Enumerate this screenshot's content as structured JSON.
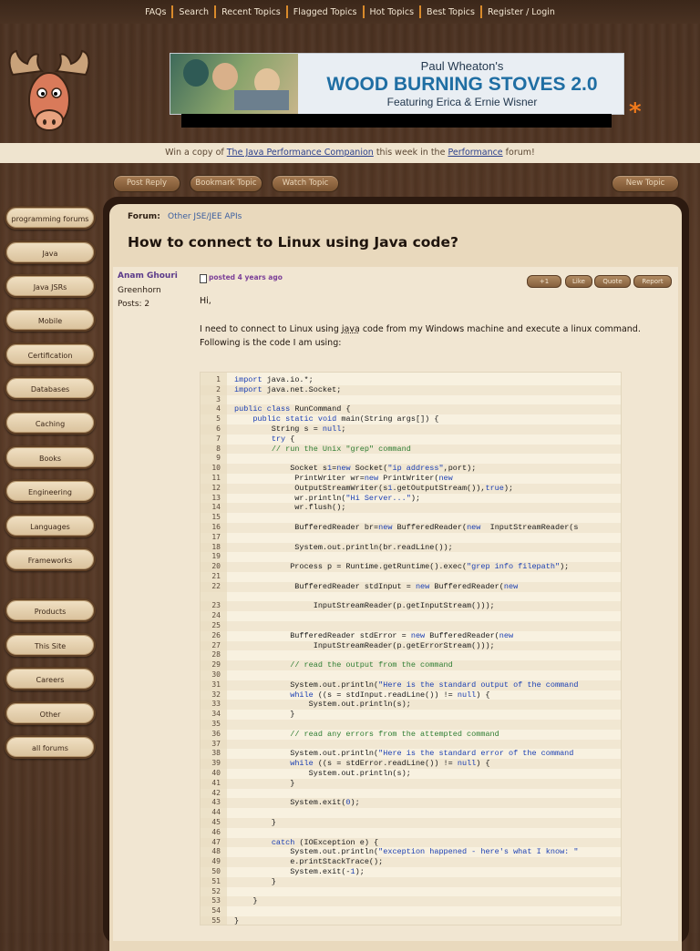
{
  "nav": {
    "items": [
      "FAQs",
      "Search",
      "Recent Topics",
      "Flagged Topics",
      "Hot Topics",
      "Best Topics",
      "Register / Login"
    ]
  },
  "banner": {
    "line1": "Paul Wheaton's",
    "line2": "WOOD BURNING STOVES 2.0",
    "line3": "Featuring Erica & Ernie Wisner"
  },
  "promo": {
    "prefix": "Win a copy of ",
    "book": "The Java Performance Companion",
    "middle": " this week in the ",
    "forum": "Performance",
    "suffix": " forum!"
  },
  "actions": {
    "post_reply": "Post Reply",
    "bookmark": "Bookmark Topic",
    "watch": "Watch Topic",
    "new_topic": "New Topic"
  },
  "sidebar": {
    "items": [
      "programming forums",
      "Java",
      "Java JSRs",
      "Mobile",
      "Certification",
      "Databases",
      "Caching",
      "Books",
      "Engineering",
      "Languages",
      "Frameworks",
      "Products",
      "This Site",
      "Careers",
      "Other",
      "all forums"
    ]
  },
  "topic": {
    "forum_label": "Forum:",
    "forum_name": "Other JSE/JEE APIs",
    "title": "How to connect to Linux using Java code?"
  },
  "post": {
    "author": "Anam Ghouri",
    "rank": "Greenhorn",
    "posts": "Posts: 2",
    "posted": "posted 4 years ago",
    "buttons": [
      "+1",
      "Like",
      "Quote",
      "Report"
    ],
    "greeting": "Hi,",
    "body_before": "I need to connect to Linux using ",
    "body_link": "java",
    "body_after": " code from my Windows machine and execute a linux command. Following is the code I am using:"
  },
  "code_lines": [
    "import java.io.*;",
    "import java.net.Socket;",
    "",
    "public class RunCommand {",
    "    public static void main(String args[]) {",
    "        String s = null;",
    "        try {",
    "        // run the Unix \"grep\" command",
    "",
    "            Socket s1=new Socket(\"ip address\",port);",
    "             PrintWriter wr=new PrintWriter(new",
    "             OutputStreamWriter(s1.getOutputStream()),true);",
    "             wr.println(\"Hi Server...\");",
    "             wr.flush();",
    "",
    "             BufferedReader br=new BufferedReader(new  InputStreamReader(s",
    "",
    "             System.out.println(br.readLine());",
    "",
    "            Process p = Runtime.getRuntime().exec(\"grep info filepath\");",
    "",
    "             BufferedReader stdInput = new BufferedReader(new",
    "",
    "                 InputStreamReader(p.getInputStream()));",
    "",
    "",
    "            BufferedReader stdError = new BufferedReader(new",
    "                 InputStreamReader(p.getErrorStream()));",
    "",
    "            // read the output from the command",
    "",
    "            System.out.println(\"Here is the standard output of the command",
    "            while ((s = stdInput.readLine()) != null) {",
    "                System.out.println(s);",
    "            }",
    "",
    "            // read any errors from the attempted command",
    "",
    "            System.out.println(\"Here is the standard error of the command",
    "            while ((s = stdError.readLine()) != null) {",
    "                System.out.println(s);",
    "            }",
    "",
    "            System.exit(0);",
    "",
    "        }",
    "",
    "        catch (IOException e) {",
    "            System.out.println(\"exception happened - here's what I know: \"",
    "            e.printStackTrace();",
    "            System.exit(-1);",
    "        }",
    "",
    "    }",
    "",
    "}"
  ],
  "code_line_numbers": [
    "1",
    "2",
    "3",
    "4",
    "5",
    "6",
    "7",
    "8",
    "9",
    "10",
    "11",
    "12",
    "13",
    "14",
    "15",
    "16",
    "17",
    "18",
    "19",
    "20",
    "21",
    "22",
    "",
    "23",
    "24",
    "25",
    "26",
    "27",
    "28",
    "29",
    "30",
    "31",
    "32",
    "33",
    "34",
    "35",
    "36",
    "37",
    "38",
    "39",
    "40",
    "41",
    "42",
    "43",
    "44",
    "45",
    "46",
    "47",
    "48",
    "49",
    "50",
    "51",
    "52",
    "53",
    "54",
    "55"
  ],
  "colors": {
    "wood": "#4a3121",
    "accent_orange": "#f07a1c",
    "link": "#3b5fa0",
    "author": "#5b3a8a",
    "keyword": "#1b3fb3",
    "comment": "#2e7d32"
  }
}
